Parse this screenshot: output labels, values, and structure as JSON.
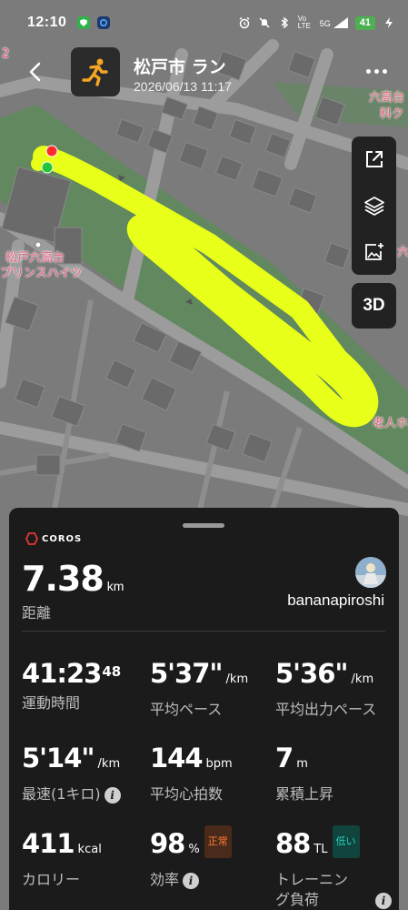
{
  "status_bar": {
    "time": "12:10",
    "network": "5G",
    "volte": "Vo LTE",
    "battery": "41"
  },
  "header": {
    "title": "松戸市 ラン",
    "datetime": "2026/06/13 11:17",
    "activity_icon": "running-person-icon"
  },
  "map": {
    "labels": {
      "place1_line1": "松戸六高台",
      "place1_line2": "プリンスハイツ",
      "place2_line1": "六高台",
      "place2_line2": "科ク",
      "place3": "老人ホ",
      "top_left_fragment": "2",
      "edge_fragment": "六"
    },
    "route_color": "#e8ff1a",
    "start_color": "#22c43a",
    "end_color": "#ff2a2a"
  },
  "map_tools": {
    "share": "share-icon",
    "layers": "layers-icon",
    "image": "add-image-icon",
    "mode_3d": "3D"
  },
  "summary": {
    "brand": "COROS",
    "distance": "7.38",
    "distance_unit": "km",
    "distance_label": "距離",
    "username": "bananapiroshi"
  },
  "stats": {
    "duration_main": "41:23",
    "duration_sup": "48",
    "duration_label": "運動時間",
    "avg_pace": "5'37\"",
    "avg_pace_unit": "/km",
    "avg_pace_label": "平均ペース",
    "avg_power_pace": "5'36\"",
    "avg_power_pace_unit": "/km",
    "avg_power_pace_label": "平均出力ペース",
    "fastest": "5'14\"",
    "fastest_unit": "/km",
    "fastest_label": "最速(1キロ)",
    "avg_hr": "144",
    "avg_hr_unit": "bpm",
    "avg_hr_label": "平均心拍数",
    "elevation": "7",
    "elevation_unit": "m",
    "elevation_label": "累積上昇",
    "calories": "411",
    "calories_unit": "kcal",
    "calories_label": "カロリー",
    "efficiency": "98",
    "efficiency_unit": "%",
    "efficiency_badge": "正常",
    "efficiency_label": "効率",
    "training_load": "88",
    "training_load_unit": "TL",
    "training_load_badge": "低い",
    "training_load_label_line1": "トレーニン",
    "training_load_label_line2": "グ負荷"
  },
  "colors": {
    "accent_badge_normal": "#ff7a3a",
    "accent_badge_low": "#29d0bd",
    "sheet_bg": "#1b1b1b"
  }
}
